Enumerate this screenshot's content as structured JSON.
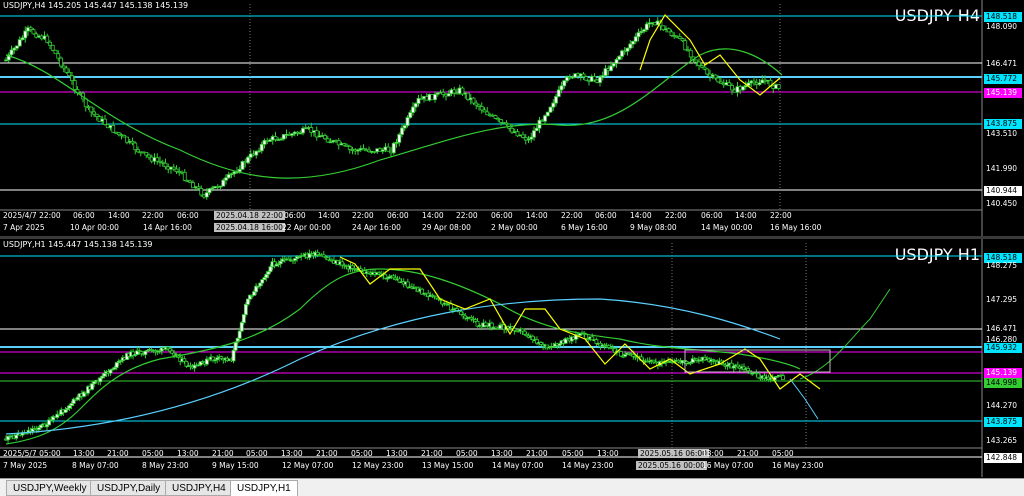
{
  "h4": {
    "info": "USDJPY,H4  145.205 145.447 145.138 145.139",
    "title": "USDJPY H4",
    "price_labels": [
      "148.090",
      "146.471",
      "143.875",
      "143.510",
      "141.990",
      "140.944",
      "140.450"
    ],
    "tags": {
      "high": "148.518",
      "cyan": "145.772",
      "magenta": "145.139"
    },
    "time_labels": [
      "2025/4/7 22:00",
      "06:00",
      "14:00",
      "22:00",
      "06:00",
      "2025.04.18 22:00",
      "06:00",
      "14:00",
      "22:00",
      "06:00",
      "14:00",
      "22:00",
      "06:00",
      "14:00",
      "22:00",
      "06:00",
      "14:00",
      "22:00",
      "06:00",
      "14:00",
      "22:00"
    ],
    "time_labels2": [
      "7 Apr 2025",
      "10 Apr 00:00",
      "14 Apr 16:00",
      "2025.04.18 16:00",
      "22 Apr 00:00",
      "24 Apr 16:00",
      "29 Apr 08:00",
      "2 May 00:00",
      "6 May 16:00",
      "9 May 08:00",
      "14 May 00:00",
      "16 May 16:00"
    ]
  },
  "h1": {
    "info": "USDJPY,H1  145.447 145.138 145.139",
    "title": "USDJPY H1",
    "price_labels": [
      "148.275",
      "147.295",
      "146.471",
      "146.280",
      "144.270",
      "143.265"
    ],
    "tags": {
      "high": "148.518",
      "cyan": "145.932",
      "magenta": "145.139",
      "green": "144.998",
      "low_cyan": "143.875",
      "bottom": "142.848"
    },
    "time_labels": [
      "7 May 2025",
      "8 May 07:00",
      "8 May 23:00",
      "9 May 15:00",
      "12 May 07:00",
      "12 May 23:00",
      "13 May 15:00",
      "14 May 07:00",
      "14 May 23:00",
      "2025.05.16 00:00",
      "16 May 07:00",
      "16 May 23:00"
    ],
    "time_labels2": [
      "2025/5/7 05:00",
      "13:00",
      "21:00",
      "05:00",
      "13:00",
      "21:00",
      "05:00",
      "13:00",
      "21:00",
      "05:00",
      "13:00",
      "21:00",
      "05:00",
      "13:00",
      "21:00",
      "05:00",
      "13:00",
      "2025.05.16 06:00",
      "13:00",
      "21:00",
      "05:00"
    ]
  },
  "tabs": [
    {
      "label": "USDJPY,Weekly",
      "active": false
    },
    {
      "label": "USDJPY,Daily",
      "active": false
    },
    {
      "label": "USDJPY,H4",
      "active": false
    },
    {
      "label": "USDJPY,H1",
      "active": true
    }
  ],
  "colors": {
    "cyan": "#00e5ff",
    "magenta": "#ff00ff",
    "green": "#33cc33",
    "yellow": "#ffff00",
    "lightblue": "#5ad0ff",
    "white": "#ffffff"
  }
}
